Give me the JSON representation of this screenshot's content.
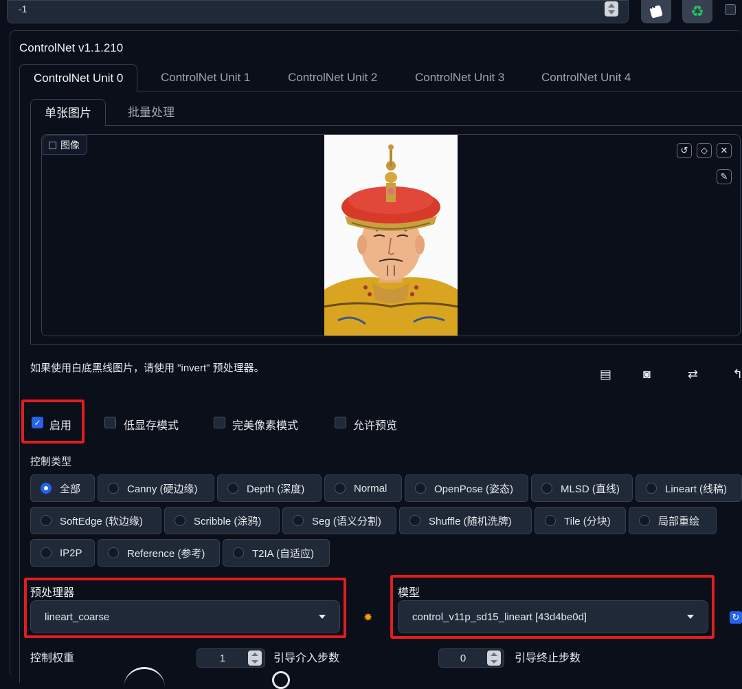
{
  "seed": {
    "value": "-1"
  },
  "controlnet": {
    "title": "ControlNet v1.1.210",
    "unit_tabs": [
      "ControlNet Unit 0",
      "ControlNet Unit 1",
      "ControlNet Unit 2",
      "ControlNet Unit 3",
      "ControlNet Unit 4"
    ],
    "sub_tabs": [
      "单张图片",
      "批量处理"
    ],
    "image_label": "图像",
    "hint": "如果使用白底黑线图片，请使用 \"invert\" 预处理器。",
    "checkboxes": [
      {
        "label": "启用",
        "checked": true
      },
      {
        "label": "低显存模式",
        "checked": false
      },
      {
        "label": "完美像素模式",
        "checked": false
      },
      {
        "label": "允许预览",
        "checked": false
      }
    ],
    "control_type_label": "控制类型",
    "control_types": [
      "全部",
      "Canny (硬边缘)",
      "Depth (深度)",
      "Normal",
      "OpenPose (姿态)",
      "MLSD (直线)",
      "Lineart (线稿)",
      "SoftEdge (软边缘)",
      "Scribble (涂鸦)",
      "Seg (语义分割)",
      "Shuffle (随机洗牌)",
      "Tile (分块)",
      "局部重绘",
      "IP2P",
      "Reference (参考)",
      "T2IA (自适应)"
    ],
    "selected_control_type": "全部",
    "preprocessor": {
      "label": "预处理器",
      "value": "lineart_coarse"
    },
    "model": {
      "label": "模型",
      "value": "control_v11p_sd15_lineart [43d4be0d]"
    },
    "weight": {
      "label": "控制权重",
      "value": "1"
    },
    "start_step": {
      "label": "引导介入步数",
      "value": "0"
    },
    "end_step": {
      "label": "引导终止步数"
    }
  },
  "colors": {
    "accent": "#2563eb",
    "highlight": "#e11d1d",
    "background": "#0b0f19"
  }
}
